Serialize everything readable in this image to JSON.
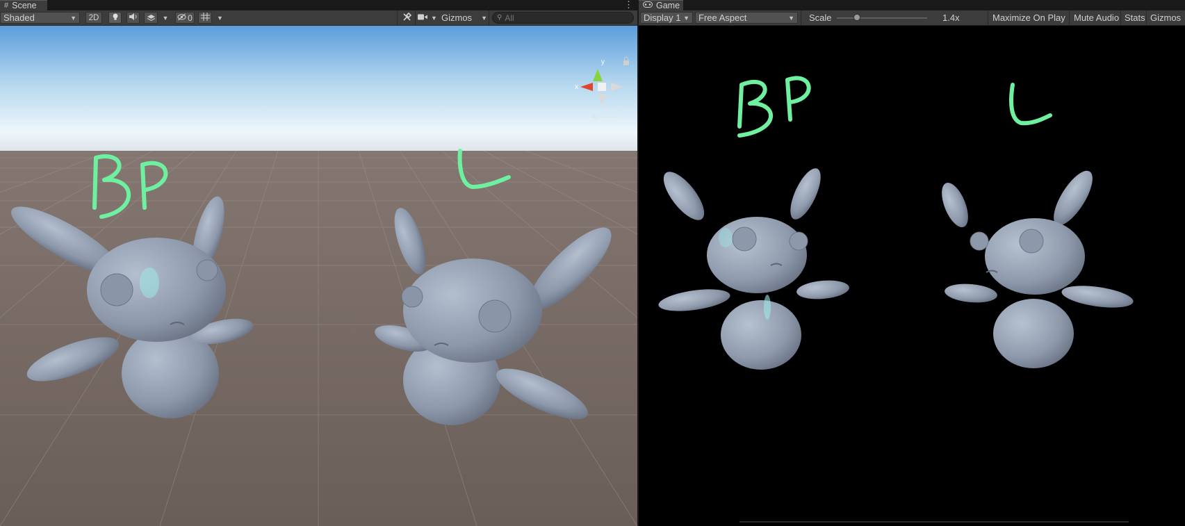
{
  "scene": {
    "tab_label": "Scene",
    "tab_icon": "grid-icon",
    "shading_mode": "Shaded",
    "mode_2d": "2D",
    "hidden_count": "0",
    "gizmos_label": "Gizmos",
    "search_placeholder": "All",
    "gizmo_axes": {
      "y": "y",
      "x": "x"
    },
    "annotations": {
      "left": "BP",
      "right": "L"
    }
  },
  "game": {
    "tab_label": "Game",
    "tab_icon": "gamepad-icon",
    "display": "Display 1",
    "aspect": "Free Aspect",
    "scale_label": "Scale",
    "scale_value": "1.4x",
    "scale_fraction": 0.2,
    "maximize_on_play": "Maximize On Play",
    "mute_audio": "Mute Audio",
    "stats": "Stats",
    "gizmos": "Gizmos",
    "annotations": {
      "left": "BP",
      "right": "L"
    }
  },
  "colors": {
    "panel_bg": "#3c3c3c",
    "ground": "#6d615a",
    "sky_top": "#5b9ddc",
    "sky_horizon": "#eef6fb",
    "model": "#8f9bad",
    "annotation": "#6ef0a0",
    "game_bg": "#000000"
  }
}
